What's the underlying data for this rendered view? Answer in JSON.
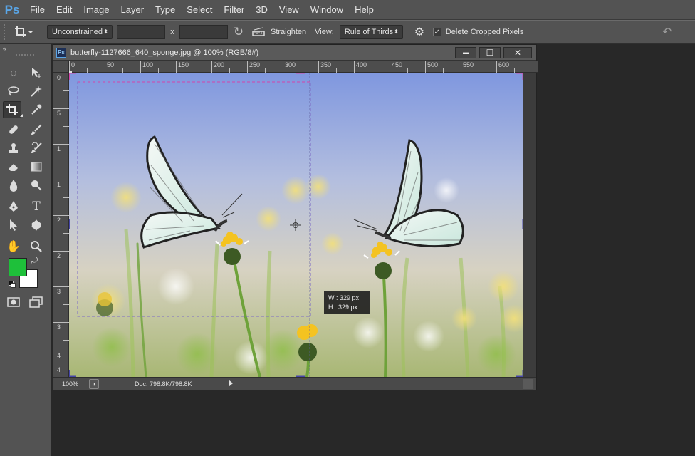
{
  "app": {
    "logo": "Ps"
  },
  "menu": [
    "File",
    "Edit",
    "Image",
    "Layer",
    "Type",
    "Select",
    "Filter",
    "3D",
    "View",
    "Window",
    "Help"
  ],
  "options": {
    "ratio": "Unconstrained",
    "by": "x",
    "straighten_label": "Straighten",
    "view_label": "View:",
    "view_value": "Rule of Thirds",
    "delete_cropped_label": "Delete Cropped Pixels",
    "delete_cropped_checked": true
  },
  "colors": {
    "foreground": "#1ec03a",
    "background": "#ffffff"
  },
  "document": {
    "badge": "Ps",
    "title": "butterfly-1127666_640_sponge.jpg @ 100% (RGB/8#)",
    "minimize": "▬",
    "maximize": "☐",
    "close": "✕",
    "ruler_h_labels": [
      "0",
      "50",
      "100",
      "150",
      "200",
      "250",
      "300",
      "350",
      "400",
      "450",
      "500",
      "550",
      "600"
    ],
    "ruler_v_labels": [
      "0",
      "5",
      "1",
      "1",
      "2",
      "2",
      "3",
      "3",
      "4",
      "4"
    ],
    "crop_tooltip": {
      "w": "W :  329 px",
      "h": "H :  329 px"
    },
    "zoom": "100%",
    "doc_size": "Doc: 798.8K/798.8K"
  }
}
